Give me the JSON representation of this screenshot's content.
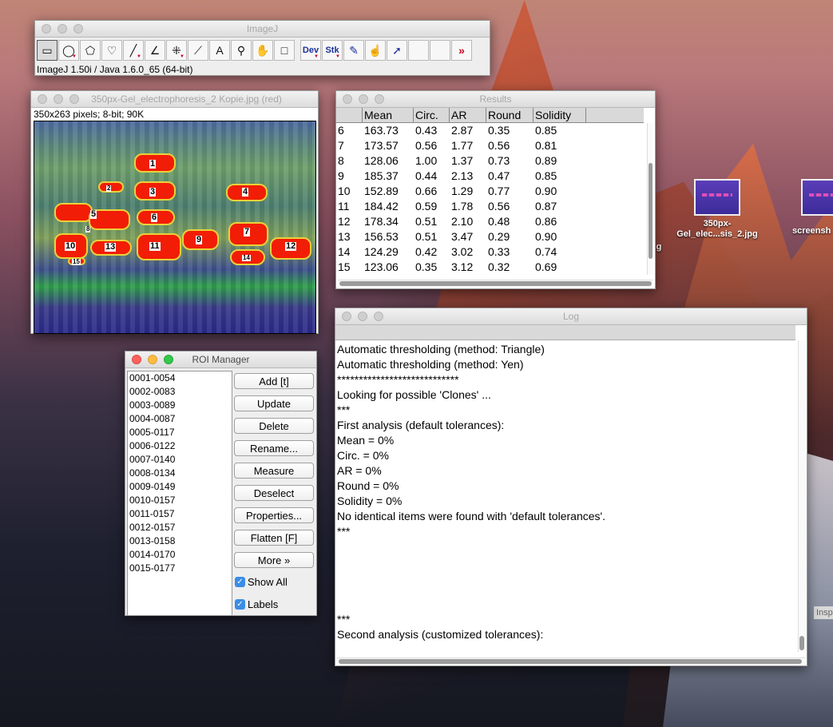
{
  "imagej": {
    "title": "ImageJ",
    "status": "ImageJ 1.50i / Java 1.6.0_65 (64-bit)",
    "tools": [
      {
        "name": "rectangle-tool-icon",
        "glyph": "▭"
      },
      {
        "name": "oval-tool-icon",
        "glyph": "◯"
      },
      {
        "name": "polygon-tool-icon",
        "glyph": "⬠"
      },
      {
        "name": "freehand-tool-icon",
        "glyph": "♡"
      },
      {
        "name": "line-tool-icon",
        "glyph": "╱"
      },
      {
        "name": "angle-tool-icon",
        "glyph": "∠"
      },
      {
        "name": "point-tool-icon",
        "glyph": "⁜"
      },
      {
        "name": "wand-tool-icon",
        "glyph": "⟋"
      },
      {
        "name": "text-tool-icon",
        "glyph": "A"
      },
      {
        "name": "magnifier-tool-icon",
        "glyph": "⚲"
      },
      {
        "name": "hand-tool-icon",
        "glyph": "✋"
      },
      {
        "name": "color-picker-icon",
        "glyph": "□"
      }
    ],
    "dev_label": "Dev",
    "stk_label": "Stk",
    "more_glyph": "»"
  },
  "image_window": {
    "title": "350px-Gel_electrophoresis_2 Kopie.jpg (red)",
    "info": "350x263 pixels; 8-bit; 90K",
    "band_labels": [
      "1",
      "2",
      "3",
      "4",
      "5",
      "6",
      "7",
      "8",
      "9",
      "10",
      "11",
      "12",
      "13",
      "14",
      "15"
    ]
  },
  "results": {
    "title": "Results",
    "columns": [
      "",
      "Mean",
      "Circ.",
      "AR",
      "Round",
      "Solidity"
    ],
    "rows": [
      [
        "6",
        "163.73",
        "0.43",
        "2.87",
        "0.35",
        "0.85"
      ],
      [
        "7",
        "173.57",
        "0.56",
        "1.77",
        "0.56",
        "0.81"
      ],
      [
        "8",
        "128.06",
        "1.00",
        "1.37",
        "0.73",
        "0.89"
      ],
      [
        "9",
        "185.37",
        "0.44",
        "2.13",
        "0.47",
        "0.85"
      ],
      [
        "10",
        "152.89",
        "0.66",
        "1.29",
        "0.77",
        "0.90"
      ],
      [
        "11",
        "184.42",
        "0.59",
        "1.78",
        "0.56",
        "0.87"
      ],
      [
        "12",
        "178.34",
        "0.51",
        "2.10",
        "0.48",
        "0.86"
      ],
      [
        "13",
        "156.53",
        "0.51",
        "3.47",
        "0.29",
        "0.90"
      ],
      [
        "14",
        "124.29",
        "0.42",
        "3.02",
        "0.33",
        "0.74"
      ],
      [
        "15",
        "123.06",
        "0.35",
        "3.12",
        "0.32",
        "0.69"
      ]
    ]
  },
  "log": {
    "title": "Log",
    "lines": [
      "Automatic thresholding (method: Triangle)",
      "Automatic thresholding (method: Yen)",
      "****************************",
      "Looking for possible 'Clones' ...",
      "***",
      "First analysis (default tolerances):",
      "Mean = 0%",
      "Circ. = 0%",
      "AR = 0%",
      "Round = 0%",
      "Solidity = 0%",
      "No identical items were found with 'default tolerances'.",
      "***"
    ],
    "tail_lines": [
      "***",
      "Second analysis (customized tolerances):"
    ]
  },
  "roi_manager": {
    "title": "ROI Manager",
    "items": [
      "0001-0054",
      "0002-0083",
      "0003-0089",
      "0004-0087",
      "0005-0117",
      "0006-0122",
      "0007-0140",
      "0008-0134",
      "0009-0149",
      "0010-0157",
      "0011-0157",
      "0012-0157",
      "0013-0158",
      "0014-0170",
      "0015-0177"
    ],
    "buttons": [
      "Add [t]",
      "Update",
      "Delete",
      "Rename...",
      "Measure",
      "Deselect",
      "Properties...",
      "Flatten [F]",
      "More »"
    ],
    "show_all": "Show All",
    "labels": "Labels",
    "show_all_checked": true,
    "labels_checked": true
  },
  "desktop": {
    "icon1_label": "350px-\nGel_elec...sis_2.jpg",
    "icon2_label": "screensh",
    "partial_left": "g",
    "partial_right": "Insp"
  }
}
